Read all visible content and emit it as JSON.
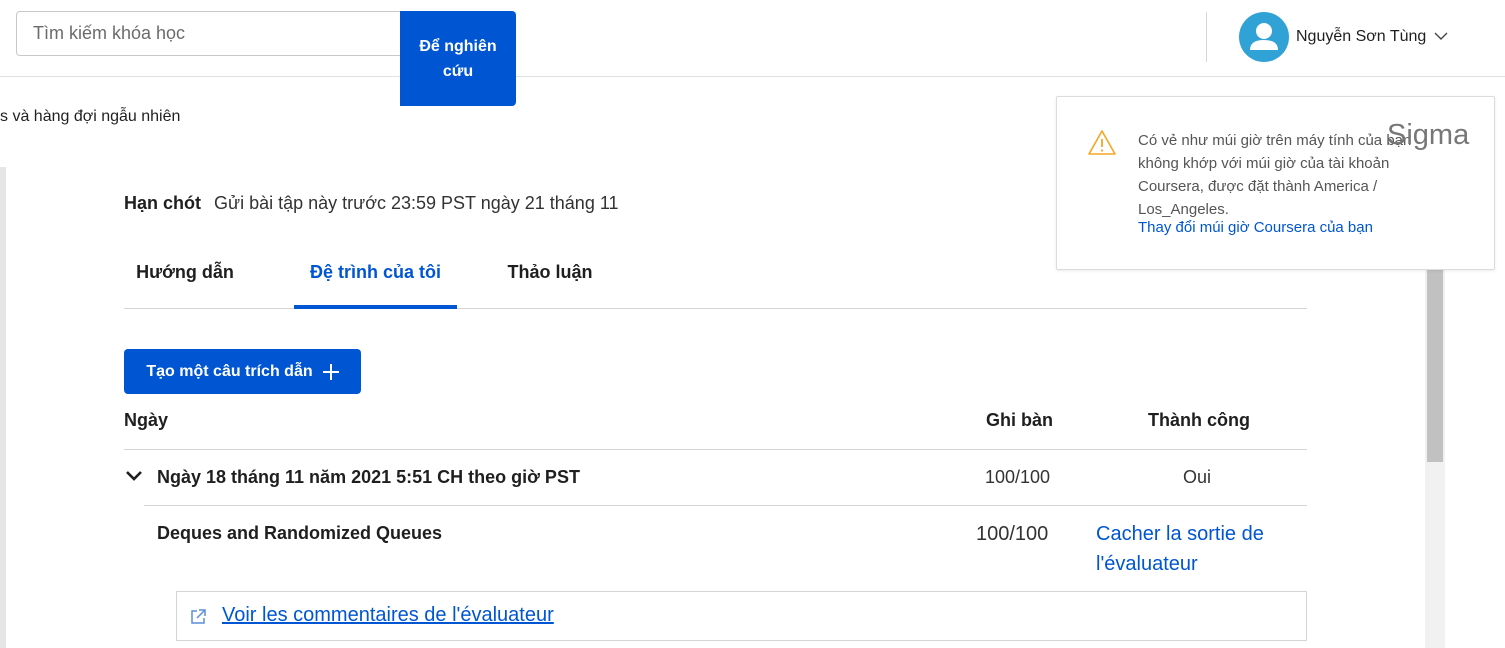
{
  "header": {
    "search_placeholder": "Tìm kiếm khóa học",
    "search_button": "Để nghiên cứu",
    "user_name": "Nguyễn Sơn Tùng"
  },
  "breadcrumb": "s và hàng đợi ngẫu nhiên",
  "deadline": {
    "label": "Hạn chót",
    "text": "Gửi bài tập này trước 23:59 PST ngày 21 tháng 11"
  },
  "tabs": [
    {
      "label": "Hướng dẫn",
      "active": false
    },
    {
      "label": "Đệ trình của tôi",
      "active": true
    },
    {
      "label": "Thảo luận",
      "active": false
    }
  ],
  "create_button": "Tạo một câu trích dẫn",
  "table": {
    "headers": {
      "date": "Ngày",
      "score": "Ghi bàn",
      "success": "Thành công"
    },
    "submission": {
      "date": "Ngày 18 tháng 11 năm 2021 5:51 CH theo giờ PST",
      "score": "100/100",
      "success": "Oui"
    },
    "part": {
      "name": "Deques and Randomized Queues",
      "score": "100/100",
      "link": "Cacher la sortie de l'évaluateur"
    },
    "feedback_link": "Voir les commentaires de l'évaluateur"
  },
  "notice": {
    "text": "Có vẻ như múi giờ trên máy tính của bạn không khớp với múi giờ của tài khoản Coursera, được đặt thành America / Los_Angeles.",
    "link": "Thay đổi múi giờ Coursera của bạn",
    "overlay": "Sigma"
  },
  "colors": {
    "primary": "#0056d2",
    "avatar": "#30a2d6",
    "warning": "#f5a623"
  }
}
